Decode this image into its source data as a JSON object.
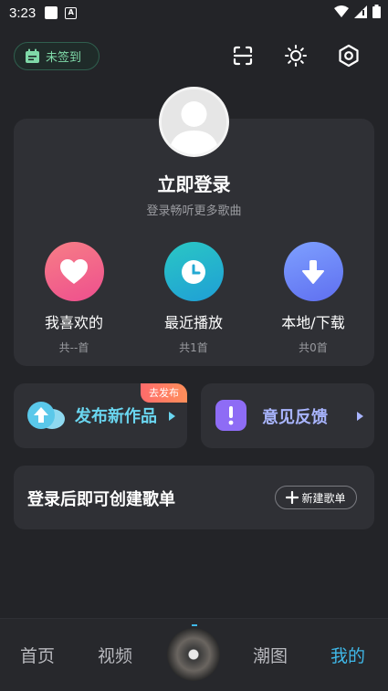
{
  "status_bar": {
    "time": "3:23",
    "a_icon": "A"
  },
  "header": {
    "checkin_label": "未签到",
    "icons": [
      "scan-icon",
      "theme-sun-icon",
      "settings-icon"
    ]
  },
  "profile": {
    "title": "立即登录",
    "subtitle": "登录畅听更多歌曲"
  },
  "shortcuts": [
    {
      "label": "我喜欢的",
      "count": "共--首",
      "icon": "heart-icon",
      "color": "#f0648a"
    },
    {
      "label": "最近播放",
      "count": "共1首",
      "icon": "clock-icon",
      "color": "#2cc0cf"
    },
    {
      "label": "本地/下载",
      "count": "共0首",
      "icon": "download-icon",
      "color": "#6f86ff"
    }
  ],
  "publish": {
    "label": "发布新作品",
    "badge": "去发布"
  },
  "feedback": {
    "label": "意见反馈"
  },
  "playlist": {
    "prompt": "登录后即可创建歌单",
    "new_button": "新建歌单"
  },
  "bottom_nav": {
    "items": [
      "首页",
      "视频",
      "潮图",
      "我的"
    ],
    "active": "我的"
  },
  "colors": {
    "accent": "#3fb8e8",
    "background": "#232428",
    "card": "#2f3035"
  }
}
